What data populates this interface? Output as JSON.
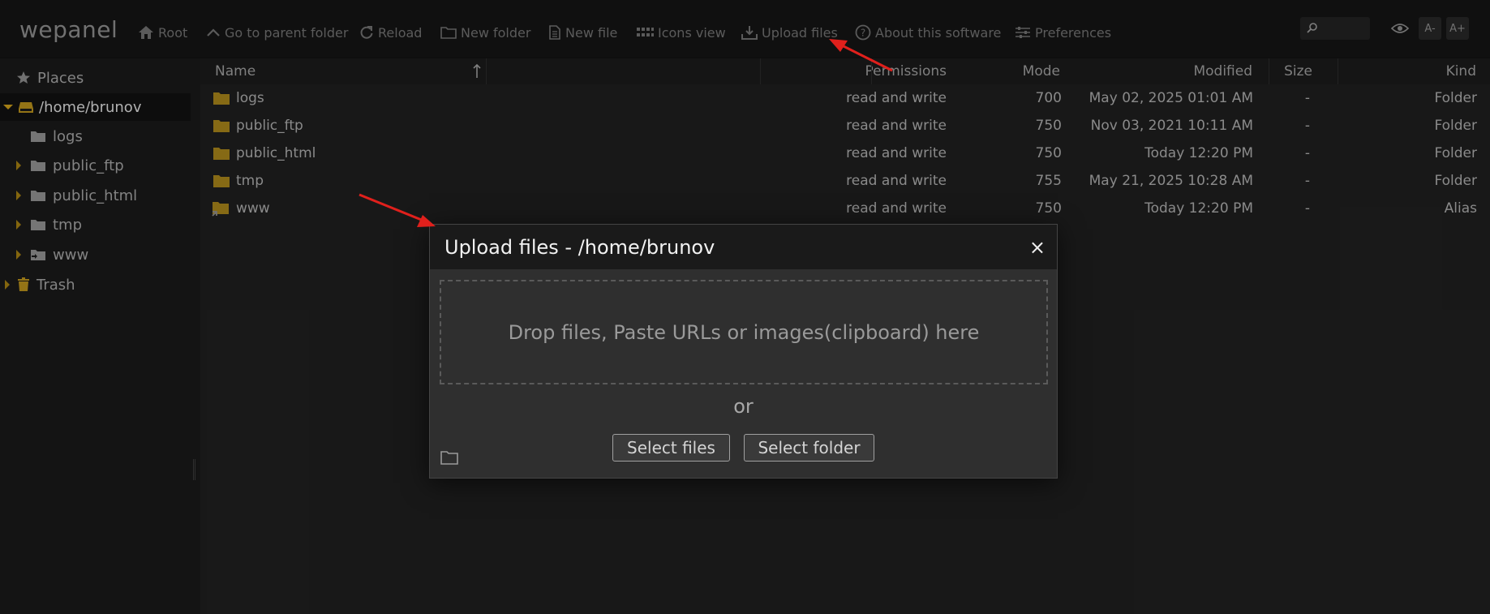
{
  "app": {
    "logo": "wepanel"
  },
  "toolbar": {
    "items": [
      {
        "label": "Root",
        "icon": "home-icon"
      },
      {
        "label": "Go to parent folder",
        "icon": "chevron-up-icon"
      },
      {
        "label": "Reload",
        "icon": "reload-icon"
      },
      {
        "label": "New folder",
        "icon": "new-folder-icon"
      },
      {
        "label": "New file",
        "icon": "new-file-icon"
      },
      {
        "label": "Icons view",
        "icon": "grid-icon"
      },
      {
        "label": "Upload files",
        "icon": "upload-icon"
      },
      {
        "label": "About this software",
        "icon": "help-icon"
      },
      {
        "label": "Preferences",
        "icon": "preferences-icon"
      }
    ],
    "search_placeholder": "",
    "font_decrease": "A-",
    "font_increase": "A+"
  },
  "sidebar": {
    "places_label": "Places",
    "root": "/home/brunov",
    "items": [
      "logs",
      "public_ftp",
      "public_html",
      "tmp",
      "www"
    ],
    "trash_label": "Trash"
  },
  "table": {
    "headers": {
      "name": "Name",
      "permissions": "Permissions",
      "mode": "Mode",
      "modified": "Modified",
      "size": "Size",
      "kind": "Kind"
    },
    "rows": [
      {
        "name": "logs",
        "permissions": "read and write",
        "mode": "700",
        "modified": "May 02, 2025 01:01 AM",
        "size": "-",
        "kind": "Folder"
      },
      {
        "name": "public_ftp",
        "permissions": "read and write",
        "mode": "750",
        "modified": "Nov 03, 2021 10:11 AM",
        "size": "-",
        "kind": "Folder"
      },
      {
        "name": "public_html",
        "permissions": "read and write",
        "mode": "750",
        "modified": "Today 12:20 PM",
        "size": "-",
        "kind": "Folder"
      },
      {
        "name": "tmp",
        "permissions": "read and write",
        "mode": "755",
        "modified": "May 21, 2025 10:28 AM",
        "size": "-",
        "kind": "Folder"
      },
      {
        "name": "www",
        "permissions": "read and write",
        "mode": "750",
        "modified": "Today 12:20 PM",
        "size": "-",
        "kind": "Alias"
      }
    ]
  },
  "dialog": {
    "title": "Upload files - /home/brunov",
    "close": "×",
    "dropzone_text": "Drop files, Paste URLs or images(clipboard) here",
    "or_text": "or",
    "select_files": "Select files",
    "select_folder": "Select folder"
  },
  "colors": {
    "folder": "#a4821a",
    "annotation_arrow": "#e0201c"
  }
}
